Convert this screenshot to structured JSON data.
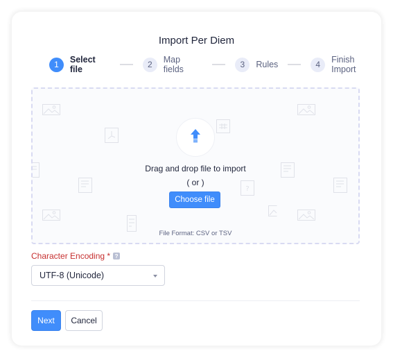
{
  "dialog": {
    "title": "Import Per Diem"
  },
  "stepper": {
    "steps": [
      {
        "number": "1",
        "label": "Select file",
        "active": true
      },
      {
        "number": "2",
        "label": "Map fields",
        "active": false
      },
      {
        "number": "3",
        "label": "Rules",
        "active": false
      },
      {
        "number": "4",
        "label": "Finish Import",
        "active": false
      }
    ]
  },
  "dropzone": {
    "icon": "upload-arrow-icon",
    "instruction": "Drag and drop file to import",
    "or_text": "( or )",
    "choose_file_label": "Choose file",
    "format_note": "File Format: CSV or TSV",
    "background_icons": [
      "image-icon",
      "pdf-icon",
      "document-icon",
      "table-icon",
      "help-file-icon"
    ]
  },
  "encoding": {
    "label": "Character Encoding *",
    "help_icon": "?",
    "selected_value": "UTF-8 (Unicode)"
  },
  "actions": {
    "next_label": "Next",
    "cancel_label": "Cancel"
  },
  "colors": {
    "accent": "#408dfb",
    "required_label": "#c62f2f",
    "text_primary": "#21263c",
    "text_secondary": "#5b6280"
  }
}
